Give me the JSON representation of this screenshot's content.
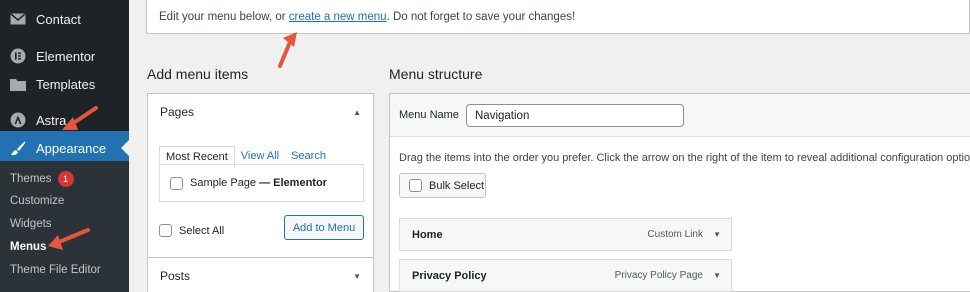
{
  "sidebar": {
    "items": [
      {
        "label": "Contact",
        "icon": "mail-icon"
      },
      {
        "label": "Elementor",
        "icon": "elementor-icon"
      },
      {
        "label": "Templates",
        "icon": "folder-icon"
      },
      {
        "label": "Astra",
        "icon": "astra-icon"
      },
      {
        "label": "Appearance",
        "icon": "brush-icon",
        "active": true
      }
    ],
    "submenu": [
      {
        "label": "Themes",
        "badge": "1"
      },
      {
        "label": "Customize"
      },
      {
        "label": "Widgets"
      },
      {
        "label": "Menus",
        "current": true
      },
      {
        "label": "Theme File Editor"
      }
    ]
  },
  "notice": {
    "before": "Edit your menu below, or ",
    "link": "create a new menu",
    "after": ". Do not forget to save your changes!"
  },
  "add_items": {
    "heading": "Add menu items",
    "pages": {
      "title": "Pages",
      "tabs": [
        "Most Recent",
        "View All",
        "Search"
      ],
      "page_item": "Sample Page",
      "page_item_suffix": " — Elementor",
      "select_all": "Select All",
      "add_button": "Add to Menu"
    },
    "posts": {
      "title": "Posts"
    }
  },
  "structure": {
    "heading": "Menu structure",
    "name_label": "Menu Name",
    "name_value": "Navigation",
    "instructions": "Drag the items into the order you prefer. Click the arrow on the right of the item to reveal additional configuration options.",
    "bulk_select": "Bulk Select",
    "items": [
      {
        "title": "Home",
        "type": "Custom Link"
      },
      {
        "title": "Privacy Policy",
        "type": "Privacy Policy Page"
      }
    ]
  },
  "colors": {
    "accent": "#2271b1",
    "sidebar": "#1d2327",
    "annotation": "#e8553e"
  }
}
